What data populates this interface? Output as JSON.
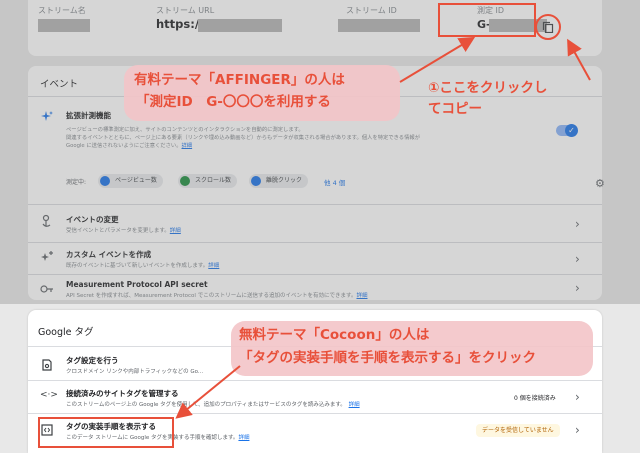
{
  "stream_details": {
    "name_label": "ストリーム名",
    "url_label": "ストリーム URL",
    "url_value": "https://",
    "id_label": "ストリーム ID",
    "measurement_id_label": "測定 ID",
    "measurement_id_value": "G-"
  },
  "events": {
    "header": "イベント",
    "enhanced_measurement": {
      "title": "拡張計測機能",
      "desc_line1": "ページビューの標準測定に加え、サイトのコンテンツとのインタラクションを自動的に測定します。",
      "desc_line2": "関連するイベントとともに、ページ上にある要素（リンクや埋め込み動画など）からもデータが収集される場合があります。個人を特定できる情報が",
      "desc_line3": "Google に送信されないようにご注意ください。",
      "detail_link": "詳細",
      "measuring_label": "測定中:",
      "chips": [
        "ページビュー数",
        "スクロール数",
        "離脱クリック"
      ],
      "more_link": "他 4 個"
    },
    "rows": [
      {
        "title": "イベントの変更",
        "desc": "受信イベントとパラメータを変更します。",
        "link": "詳細"
      },
      {
        "title": "カスタム イベントを作成",
        "desc": "既存のイベントに基づいて新しいイベントを作成します。",
        "link": "詳細"
      },
      {
        "title": "Measurement Protocol API secret",
        "desc": "API Secret を作成すれば、Measurement Protocol でこのストリームに送信する追加のイベントを有効にできます。",
        "link": "詳細"
      }
    ]
  },
  "google_tag": {
    "header": "Google タグ",
    "rows": [
      {
        "title": "タグ設定を行う",
        "desc": "クロスドメイン リンクや内部トラフィックなどの Go..."
      },
      {
        "title": "接続済みのサイトタグを管理する",
        "desc": "このストリームのページ上の Google タグを使用して、追加のプロパティまたはサービスのタグを読み込みます。",
        "link": "詳細",
        "badge": "0 個を接続済み"
      },
      {
        "title": "タグの実装手順を表示する",
        "desc": "このデータ ストリームに Google タグを実装する手順を確認します。",
        "link": "詳細",
        "badge": "データを受信していません"
      }
    ]
  },
  "annotations": {
    "affinger_line1": "有料テーマ「AFFINGER」の人は",
    "affinger_line2": "「測定ID　G-〇〇〇を利用する",
    "copy_line1": "①ここをクリックし",
    "copy_line2": "てコピー",
    "cocoon_line1": "無料テーマ「Cocoon」の人は",
    "cocoon_line2": "「タグの実装手順を手順を表示する」をクリック"
  },
  "colors": {
    "accent_red": "#e8503a",
    "pink_bg": "#f3c4c8",
    "link_blue": "#1a73e8"
  }
}
